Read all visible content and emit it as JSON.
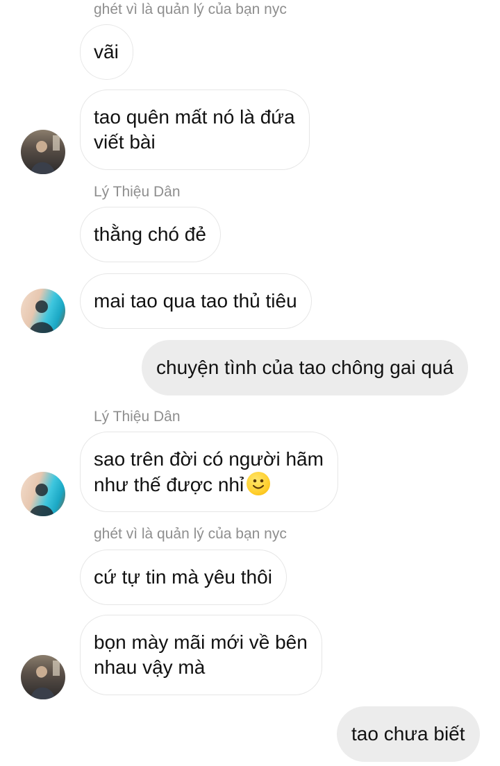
{
  "messages": [
    {
      "sender": "ghét vì là quản lý của bạn nyc",
      "text": "vãi"
    },
    {
      "text": "tao quên mất nó là đứa",
      "text2": "viết bài"
    },
    {
      "sender": "Lý Thiệu Dân",
      "text": "thằng chó đẻ"
    },
    {
      "text": "mai tao qua tao thủ tiêu"
    },
    {
      "text": "chuyện tình của tao chông gai quá"
    },
    {
      "sender": "Lý Thiệu Dân",
      "text": "sao trên đời có người hãm",
      "text2": "như thế được nhỉ"
    },
    {
      "sender": "ghét vì là quản lý của bạn nyc",
      "text": "cứ tự tin mà yêu thôi"
    },
    {
      "text": "bọn mày mãi mới về bên",
      "text2": "nhau vậy mà"
    },
    {
      "text": "tao chưa biết"
    }
  ],
  "icons": {
    "emoji": "slightly-smiling-face-icon",
    "avatar_1": "user-avatar-photo",
    "avatar_2": "user-avatar-silhouette"
  },
  "colors": {
    "incoming_bubble": "#ffffff",
    "incoming_border": "#e6e6e6",
    "outgoing_bubble": "#ececec",
    "sender_name": "#8e8e8e",
    "text": "#111111"
  }
}
